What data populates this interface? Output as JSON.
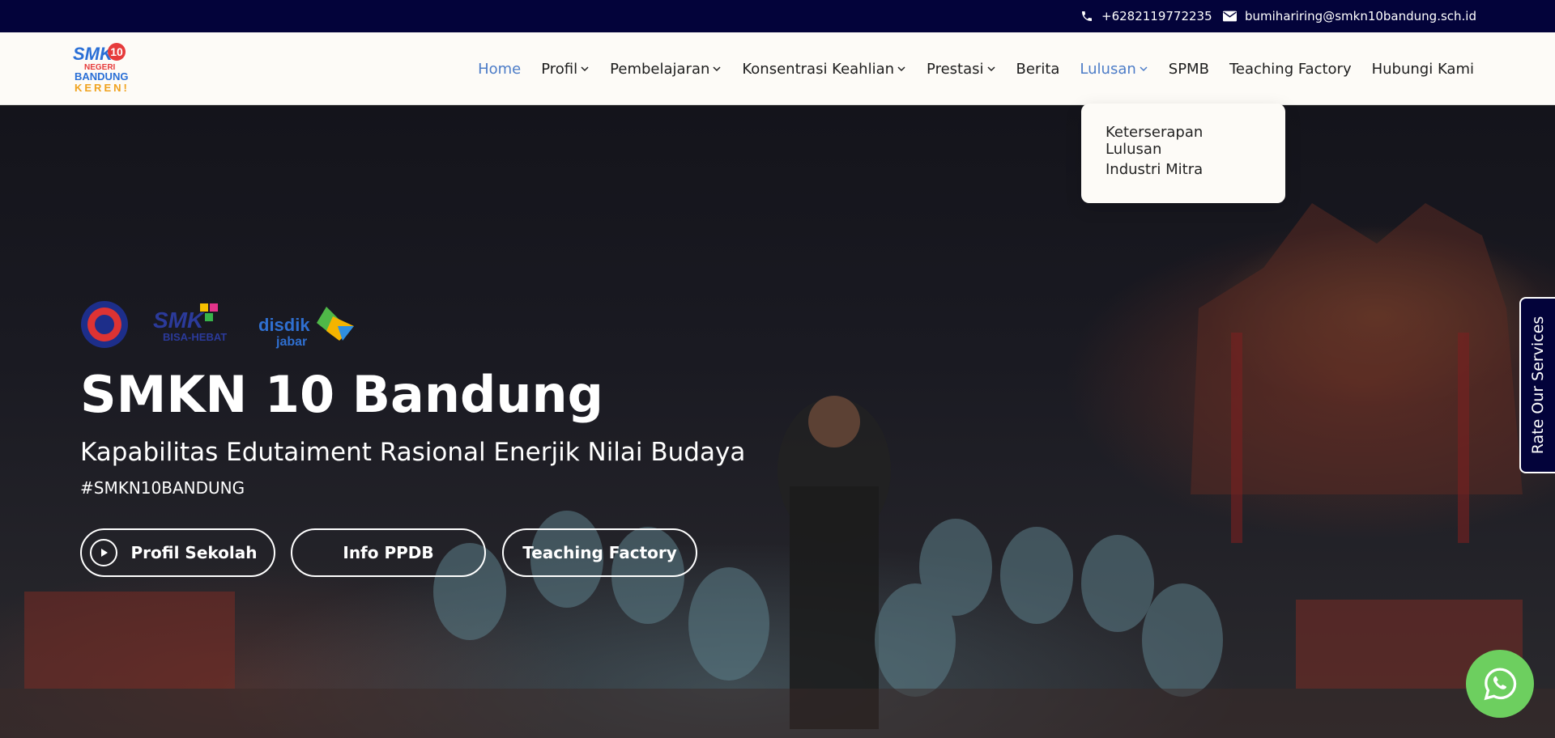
{
  "topbar": {
    "phone": "+6282119772235",
    "email": "bumihariring@smkn10bandung.sch.id",
    "phone_icon": "phone-icon",
    "email_icon": "envelope-icon"
  },
  "logo": {
    "line1": "SMK",
    "number": "10",
    "line2": "NEGERI",
    "line3": "BANDUNG",
    "line4": "KEREN!"
  },
  "nav": {
    "items": [
      {
        "label": "Home",
        "active": true
      },
      {
        "label": "Profil",
        "has_dropdown": true
      },
      {
        "label": "Pembelajaran",
        "has_dropdown": true
      },
      {
        "label": "Konsentrasi Keahlian",
        "has_dropdown": true
      },
      {
        "label": "Prestasi",
        "has_dropdown": true
      },
      {
        "label": "Berita"
      },
      {
        "label": "Lulusan",
        "has_dropdown": true,
        "open": true
      },
      {
        "label": "SPMB"
      },
      {
        "label": "Teaching Factory"
      },
      {
        "label": "Hubungi Kami"
      }
    ],
    "active_color": "#4c7cc7"
  },
  "dropdown": {
    "items": [
      "Keterserapan Lulusan",
      "Industri Mitra"
    ]
  },
  "hero": {
    "badges": {
      "badge2_line1": "SMK",
      "badge2_line2": "BISA-HEBAT",
      "badge3_line1": "disdik",
      "badge3_line2": "jabar"
    },
    "title": "SMKN 10 Bandung",
    "subtitle": "Kapabilitas Edutaiment Rasional Enerjik Nilai Budaya",
    "hashtag": "#SMKN10BANDUNG",
    "buttons": {
      "profil": "Profil Sekolah",
      "ppdb": "Info PPDB",
      "tefa": "Teaching Factory"
    }
  },
  "rate_tab": {
    "label": "Rate Our Services"
  },
  "colors": {
    "topbar": "#03033a",
    "whatsapp": "#6dcf5f"
  }
}
